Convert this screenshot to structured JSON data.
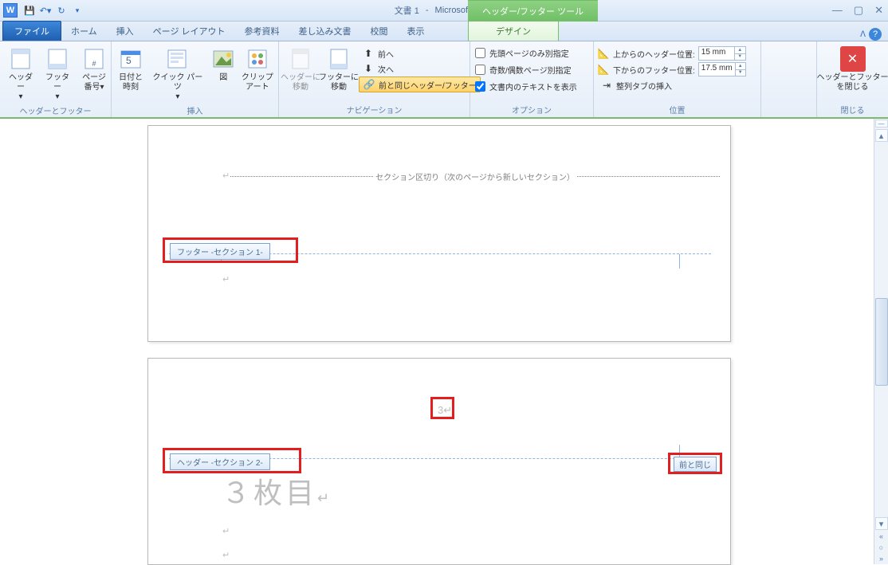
{
  "title": {
    "doc": "文書 1",
    "app": "Microsoft Word"
  },
  "context_tab": "ヘッダー/フッター ツール",
  "tabs": {
    "file": "ファイル",
    "items": [
      "ホーム",
      "挿入",
      "ページ レイアウト",
      "参考資料",
      "差し込み文書",
      "校閲",
      "表示"
    ],
    "design": "デザイン"
  },
  "ribbon": {
    "g1": {
      "label": "ヘッダーとフッター",
      "header": "ヘッダー",
      "footer": "フッター",
      "page_no": "ページ\n番号"
    },
    "g2": {
      "label": "挿入",
      "datetime": "日付と\n時刻",
      "quick": "クイック パーツ",
      "pic": "図",
      "clip": "クリップ\nアート"
    },
    "g3": {
      "label": "ナビゲーション",
      "goh": "ヘッダーに\n移動",
      "gof": "フッターに\n移動",
      "prev": "前へ",
      "next": "次へ",
      "link": "前と同じヘッダー/フッター"
    },
    "g4": {
      "label": "オプション",
      "first": "先頭ページのみ別指定",
      "odd": "奇数/偶数ページ別指定",
      "show": "文書内のテキストを表示"
    },
    "g5": {
      "label": "位置",
      "top": "上からのヘッダー位置:",
      "top_v": "15 mm",
      "bot": "下からのフッター位置:",
      "bot_v": "17.5 mm",
      "align": "整列タブの挿入"
    },
    "g6": {
      "label": "閉じる",
      "close": "ヘッダーとフッター\nを閉じる"
    }
  },
  "doc": {
    "section_break": "セクション区切り（次のページから新しいセクション）",
    "footer_tag": "フッター -セクション 1-",
    "header_tag": "ヘッダー -セクション 2-",
    "same_as": "前と同じ",
    "page_num": "3",
    "body": "３枚目"
  }
}
